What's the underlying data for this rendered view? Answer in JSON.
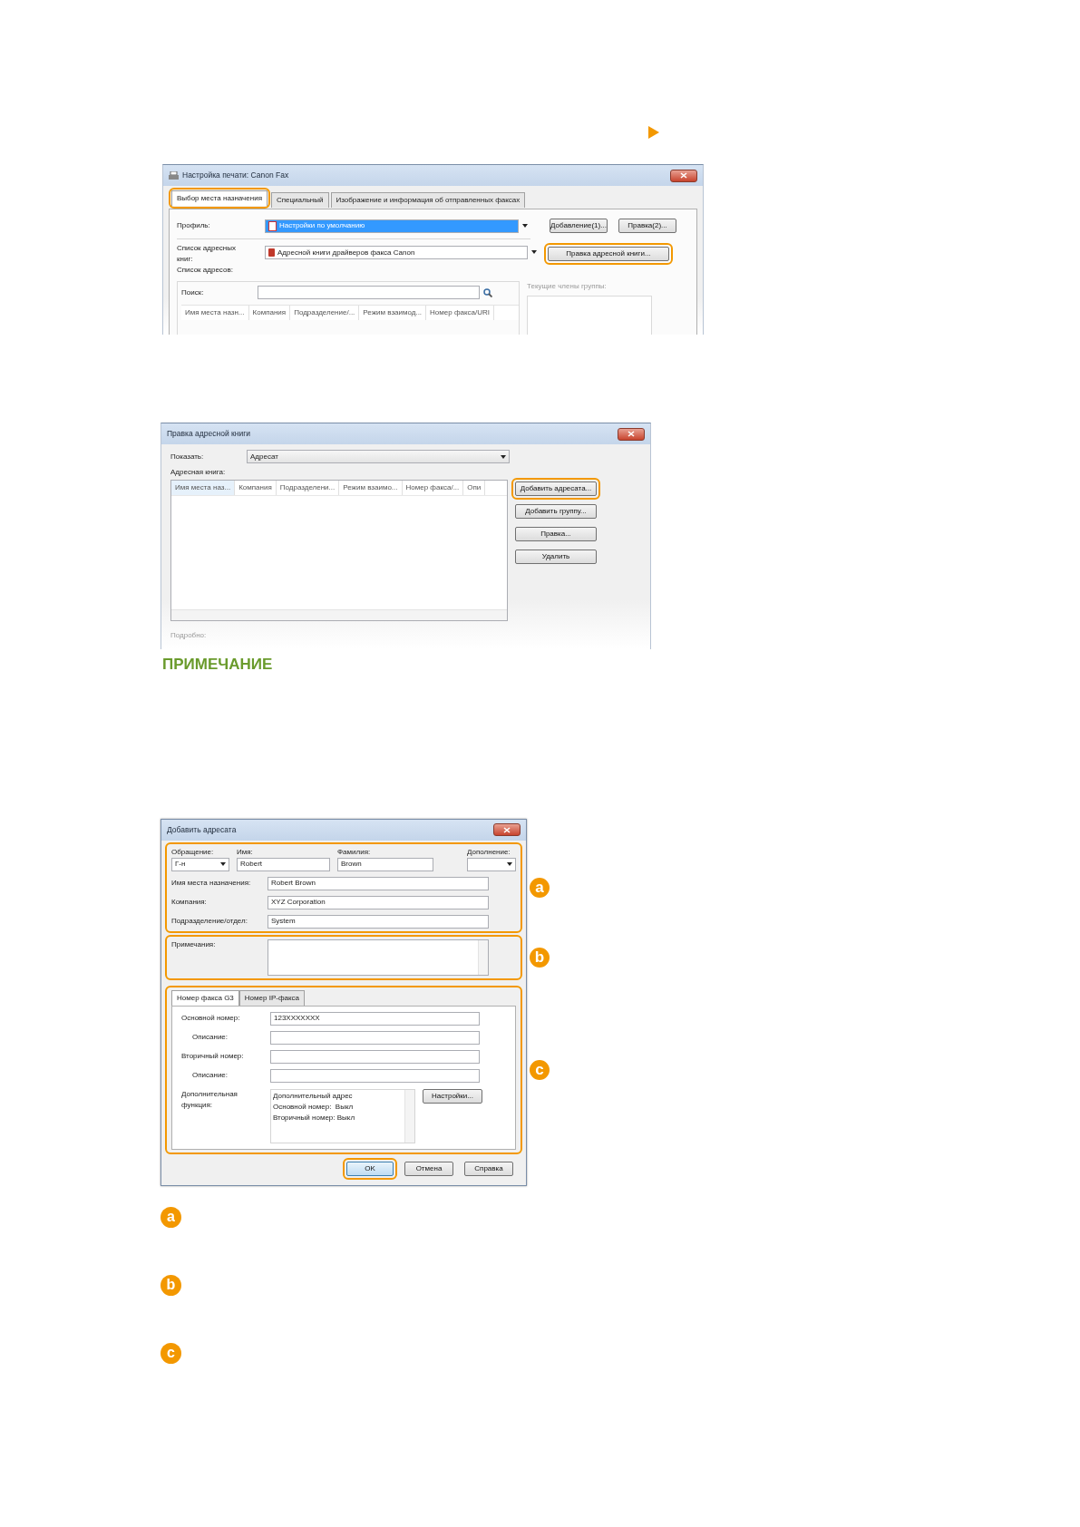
{
  "print_settings_dialog": {
    "title": "Настройка печати: Canon Fax",
    "tabs": [
      {
        "label": "Выбор места назначения",
        "selected": true,
        "highlighted": true
      },
      {
        "label": "Специальный",
        "selected": false,
        "highlighted": false
      },
      {
        "label": "Изображение и информация об отправленных факсах",
        "selected": false,
        "highlighted": false
      }
    ],
    "profile_label": "Профиль:",
    "profile_value": "Настройки по умолчанию",
    "profile_buttons": [
      {
        "label": "Добавление(1)...",
        "highlighted": false
      },
      {
        "label": "Правка(2)...",
        "highlighted": false
      }
    ],
    "address_books_label": "Список адресных книг:",
    "address_book_value": "Адресной книги драйверов факса Canon",
    "edit_book_button": {
      "label": "Правка адресной книги...",
      "highlighted": true
    },
    "address_list_label": "Список адресов:",
    "search_label": "Поиск:",
    "group_members_label": "Текущие члены группы:",
    "columns": [
      "Имя места назн...",
      "Компания",
      "Подразделение/...",
      "Режим взаимод...",
      "Номер факса/URI"
    ]
  },
  "edit_address_book_dialog": {
    "title": "Правка адресной книги",
    "show_label": "Показать:",
    "show_value": "Адресат",
    "book_label": "Адресная книга:",
    "columns": [
      "Имя места наз...",
      "Компания",
      "Подразделени...",
      "Режим взаимо...",
      "Номер факса/...",
      "Опи"
    ],
    "buttons": [
      {
        "label": "Добавить адресата...",
        "highlighted": true
      },
      {
        "label": "Добавить группу...",
        "highlighted": false
      },
      {
        "label": "Правка...",
        "highlighted": false
      },
      {
        "label": "Удалить",
        "highlighted": false
      }
    ],
    "details_label": "Подробно:"
  },
  "note_heading": "ПРИМЕЧАНИЕ",
  "add_recipient_dialog": {
    "title": "Добавить адресата",
    "name_section": {
      "callout": "a",
      "highlighted": true,
      "name_fields": [
        {
          "kind": "dropdown",
          "label": "Обращение:",
          "value": "Г-н"
        },
        {
          "kind": "text",
          "label": "Имя:",
          "value": "Robert"
        },
        {
          "kind": "text",
          "label": "Фамилия:",
          "value": "Brown"
        },
        {
          "kind": "dropdown",
          "label": "Дополнение:"
        }
      ],
      "rows": [
        {
          "label": "Имя места назначения:",
          "value": "Robert Brown"
        },
        {
          "label": "Компания:",
          "value": "XYZ Corporation"
        },
        {
          "label": "Подразделение/отдел:",
          "value": "System"
        }
      ]
    },
    "notes_section": {
      "callout": "b",
      "highlighted": true,
      "label": "Примечания:"
    },
    "fax_section": {
      "callout": "c",
      "highlighted": true,
      "tabs": [
        {
          "label": "Номер факса G3",
          "selected": true
        },
        {
          "label": "Номер IP-факса",
          "selected": false
        }
      ],
      "rows": [
        {
          "kind": "number",
          "label": "Основной номер:",
          "value": "123XXXXXXX"
        },
        {
          "kind": "description",
          "label": "Описание:"
        },
        {
          "kind": "number",
          "label": "Вторичный номер:"
        },
        {
          "kind": "description",
          "label": "Описание:"
        }
      ],
      "extra_label": "Дополнительная функция:",
      "extra_lines": [
        "Дополнительный адрес",
        "Основной номер:  Выкл",
        "Вторичный номер: Выкл"
      ],
      "settings_button": "Настройки..."
    },
    "buttons": [
      {
        "label": "OK",
        "highlighted": true
      },
      {
        "label": "Отмена",
        "highlighted": false
      },
      {
        "label": "Справка",
        "highlighted": false
      }
    ]
  },
  "legend": [
    "a",
    "b",
    "c"
  ]
}
